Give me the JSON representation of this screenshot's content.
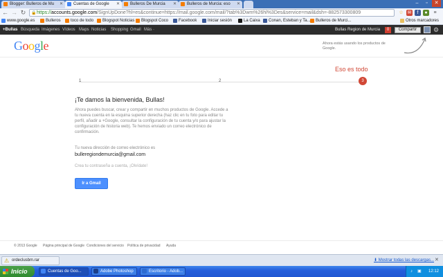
{
  "browser": {
    "tabs": [
      {
        "label": "Blogger: Bulleros de Mu",
        "favicon": "blogger-icon",
        "color": "#f57d00"
      },
      {
        "label": "Cuentas de Google",
        "favicon": "google-icon",
        "color": "#4285f4"
      },
      {
        "label": "Bulleros De Murcia",
        "favicon": "blogger-icon",
        "color": "#f57d00"
      },
      {
        "label": "Bulleros de Murcia: eso",
        "favicon": "blogger-icon",
        "color": "#f57d00"
      }
    ],
    "url_scheme": "https://",
    "url_host": "accounts.google.com",
    "url_rest": "/SignUpDone?hl=es&continue=https://mail.google.com/mail/?tab%3Dwm%26hl%3Des&service=mail&dsh=-882573300809",
    "bookmarks": [
      {
        "label": "www.google.es",
        "color": "#4285f4"
      },
      {
        "label": "Bulleros",
        "color": "#f57d00"
      },
      {
        "label": "toco de todo",
        "color": "#f57d00"
      },
      {
        "label": "Blogspot Noticias",
        "color": "#f57d00"
      },
      {
        "label": "Blogspot Coco",
        "color": "#f57d00"
      },
      {
        "label": "Facebook",
        "color": "#3b5998"
      },
      {
        "label": "Iniciar sesión",
        "color": "#3b5998"
      },
      {
        "label": "La Caixa",
        "color": "#1a1a1a"
      },
      {
        "label": "Conan, Esteban y Ta...",
        "color": "#3b5998"
      },
      {
        "label": "Bulleros de Murci...",
        "color": "#f57d00"
      }
    ],
    "other_bookmarks": "Otros marcadores"
  },
  "gbar": {
    "items": [
      "+Bullas",
      "Búsqueda",
      "Imágenes",
      "Vídeos",
      "Maps",
      "Noticias",
      "Shopping",
      "Gmail",
      "Más ·"
    ],
    "user_name": "Bullas Region de Murcia",
    "notifications": "0",
    "share_label": "Compartir"
  },
  "header": {
    "logo": "Google",
    "note": "Ahora estás usando los productos de Google."
  },
  "progress": {
    "label": "Eso es todo",
    "steps": [
      "1",
      "2",
      "3"
    ]
  },
  "main": {
    "welcome": "¡Te damos la bienvenida, Bullas!",
    "intro": "Ahora puedes buscar, crear y compartir en muchos productos de Google. Accede a tu nueva cuenta en la esquina superior derecha (haz clic en tu foto para editar tu perfil, añadir a +Google, consultar la configuración de tu cuenta y/o para ajustar la configuración de historia web). Te hemos enviado un correo electrónico de confirmación.",
    "address_label": "Tu nueva dirección de correo electrónico es",
    "address": "bulleregiondemurcia@gmail.com",
    "forgot": "Crea tu contraseña a cuenta, ¡Olvídate!",
    "gmail_button": "Ir a Gmail"
  },
  "footer": {
    "links": [
      "© 2013 Google",
      "Página principal de Google",
      "Condiciones del servicio",
      "Política de privacidad",
      "Ayuda"
    ]
  },
  "downloads": {
    "file": "ordeclusbm.rar",
    "show_all": "Mostrar todas las descargas..."
  },
  "taskbar": {
    "start": "Inicio",
    "tasks": [
      {
        "label": "Cuentas de Goo...",
        "color": "#4285f4"
      },
      {
        "label": "Adobe Photoshop",
        "color": "#1c3f8a"
      },
      {
        "label": "Escritorio - Adob...",
        "color": "#2d6bd0"
      }
    ],
    "clock": "12:12"
  }
}
